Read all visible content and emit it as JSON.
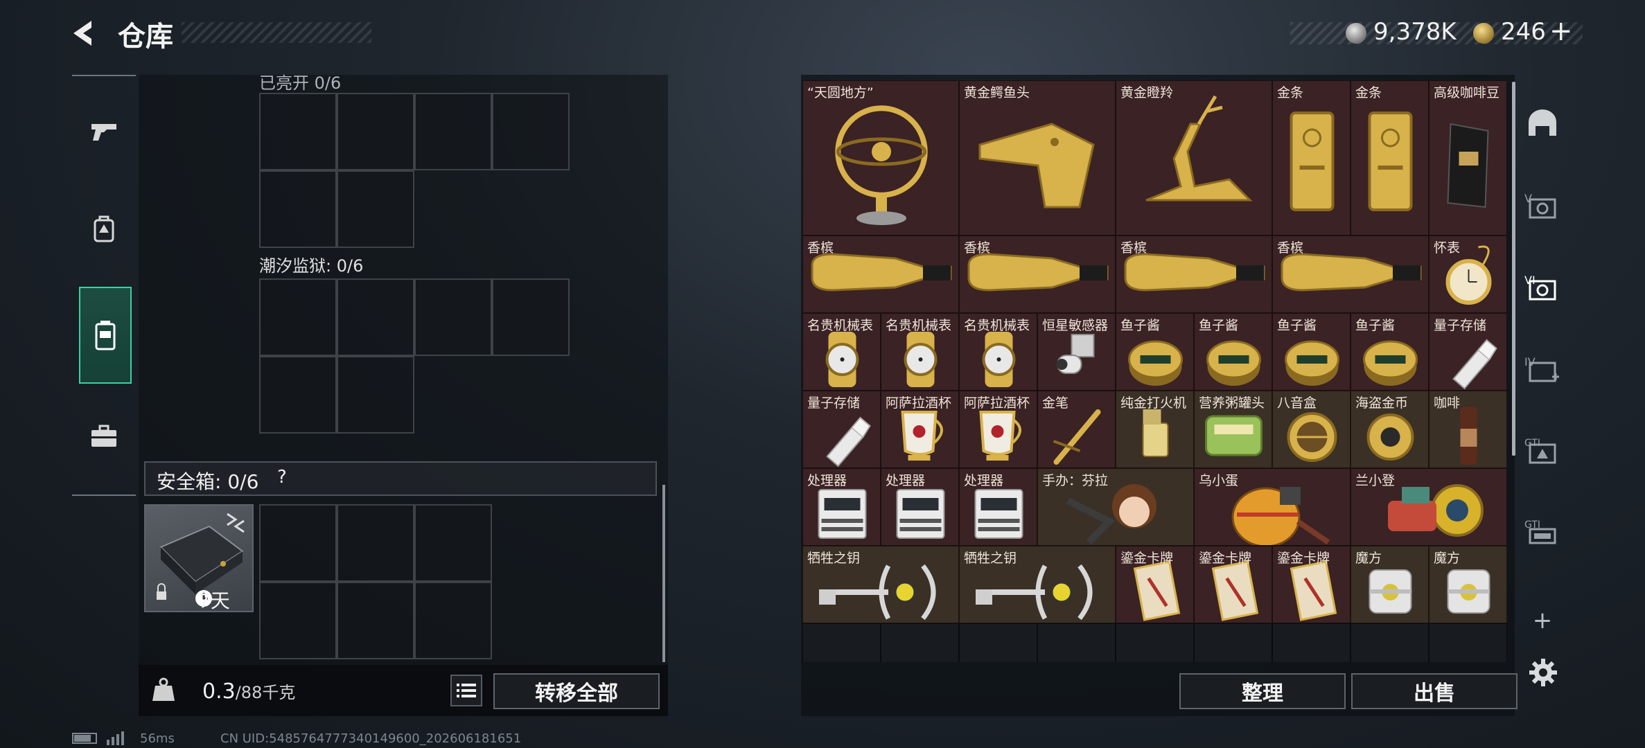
{
  "header": {
    "title": "仓库"
  },
  "currency": {
    "coin": "9,378K",
    "gem": "246",
    "gem_plus": "+"
  },
  "left_nav": [
    {
      "icon": "pistol-icon"
    },
    {
      "icon": "backpack-icon"
    },
    {
      "icon": "vest-icon",
      "active": true
    },
    {
      "icon": "briefcase-icon"
    }
  ],
  "left_panel": {
    "section1_label": "已亮开 0/6",
    "section2_label": "潮汐监狱: 0/6",
    "safebox_label": "安全箱:  0/6",
    "safebox_help": "?",
    "safebox_days": "7天",
    "weight_value": "0.3",
    "weight_unit": "/88千克",
    "transfer_all": "转移全部"
  },
  "items": [
    {
      "name": "“天圆地方”",
      "color": "red",
      "art": "globe"
    },
    {
      "name": "黄金鳄鱼头",
      "color": "red",
      "art": "croc"
    },
    {
      "name": "黄金瞪羚",
      "color": "red",
      "art": "gazelle"
    },
    {
      "name": "金条",
      "color": "red",
      "art": "goldbar"
    },
    {
      "name": "金条",
      "color": "red",
      "art": "goldbar"
    },
    {
      "name": "高级咖啡豆",
      "color": "red",
      "art": "coffeebag"
    },
    {
      "name": "香槟",
      "color": "red",
      "art": "bottle"
    },
    {
      "name": "香槟",
      "color": "red",
      "art": "bottle"
    },
    {
      "name": "香槟",
      "color": "red",
      "art": "bottle"
    },
    {
      "name": "香槟",
      "color": "red",
      "art": "bottle"
    },
    {
      "name": "怀表",
      "color": "red",
      "art": "pocketwatch"
    },
    {
      "name": "名贵机械表",
      "color": "red",
      "art": "watch"
    },
    {
      "name": "名贵机械表",
      "color": "red",
      "art": "watch"
    },
    {
      "name": "名贵机械表",
      "color": "red",
      "art": "watch"
    },
    {
      "name": "恒星敏感器",
      "color": "red",
      "art": "sensor"
    },
    {
      "name": "鱼子酱",
      "color": "red",
      "art": "caviar"
    },
    {
      "name": "鱼子酱",
      "color": "red",
      "art": "caviar"
    },
    {
      "name": "鱼子酱",
      "color": "red",
      "art": "caviar"
    },
    {
      "name": "鱼子酱",
      "color": "red",
      "art": "caviar"
    },
    {
      "name": "量子存储",
      "color": "red",
      "art": "usb"
    },
    {
      "name": "量子存储",
      "color": "red",
      "art": "usb"
    },
    {
      "name": "阿萨拉酒杯",
      "color": "red",
      "art": "cup"
    },
    {
      "name": "阿萨拉酒杯",
      "color": "red",
      "art": "cup"
    },
    {
      "name": "金笔",
      "color": "red",
      "art": "pen"
    },
    {
      "name": "纯金打火机",
      "color": "brown",
      "art": "lighter"
    },
    {
      "name": "营养粥罐头",
      "color": "brown",
      "art": "tin"
    },
    {
      "name": "八音盒",
      "color": "brown",
      "art": "musicbox"
    },
    {
      "name": "海盗金币",
      "color": "brown",
      "art": "coin"
    },
    {
      "name": "咖啡",
      "color": "brown",
      "art": "coffee"
    },
    {
      "name": "处理器",
      "color": "red",
      "art": "cpu"
    },
    {
      "name": "处理器",
      "color": "red",
      "art": "cpu"
    },
    {
      "name": "处理器",
      "color": "red",
      "art": "cpu"
    },
    {
      "name": "手办：芬拉",
      "color": "brown",
      "art": "figure"
    },
    {
      "name": "乌小蛋",
      "color": "red",
      "art": "egg"
    },
    {
      "name": "兰小登",
      "color": "red",
      "art": "robot"
    },
    {
      "name": "牺牲之钥",
      "color": "brown",
      "art": "key"
    },
    {
      "name": "牺牲之钥",
      "color": "brown",
      "art": "key"
    },
    {
      "name": "鎏金卡牌",
      "color": "red",
      "art": "card"
    },
    {
      "name": "鎏金卡牌",
      "color": "red",
      "art": "card"
    },
    {
      "name": "鎏金卡牌",
      "color": "red",
      "art": "card"
    },
    {
      "name": "魔方",
      "color": "brown",
      "art": "cube"
    },
    {
      "name": "魔方",
      "color": "brown",
      "art": "cube"
    }
  ],
  "actions": {
    "sort": "整理",
    "sell": "出售"
  },
  "right_tabs": [
    "helmet-icon",
    "v-icon",
    "vi-icon",
    "iv-icon",
    "gti-icon",
    "gti2-icon"
  ],
  "right_add": "+",
  "status": {
    "ping": "56ms",
    "uid": "CN UID:5485764777340149600_202606181651"
  }
}
